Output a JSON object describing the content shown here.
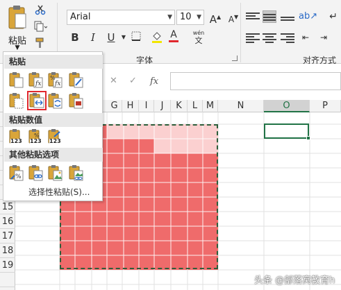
{
  "ribbon": {
    "font_name": "Arial",
    "font_size": "10",
    "paste_label": "粘贴",
    "font_group_label": "字体",
    "align_group_label": "对齐方式",
    "bold": "B",
    "italic": "I",
    "underline": "U",
    "wen_label": "wén",
    "wen_char": "文",
    "grow_font": "A",
    "shrink_font": "A",
    "font_color": "A"
  },
  "formula_bar": {
    "fx_label": "fx",
    "value": ""
  },
  "columns": [
    "G",
    "H",
    "I",
    "J",
    "K",
    "L",
    "M",
    "N",
    "O",
    "P"
  ],
  "selected_column": "O",
  "rows": [
    "15",
    "16",
    "17",
    "18",
    "19"
  ],
  "paste_menu": {
    "section_paste": "粘贴",
    "section_values": "粘贴数值",
    "section_other": "其他粘贴选项",
    "value_badge": "123",
    "special_link": "选择性粘贴(S)..."
  },
  "colors": {
    "accent_green": "#217346",
    "fill_red": "#ef6b6b",
    "fill_pink": "#fbd0d0",
    "highlight_red": "#e0282e"
  },
  "watermark": "头条 @部落窝教育h"
}
